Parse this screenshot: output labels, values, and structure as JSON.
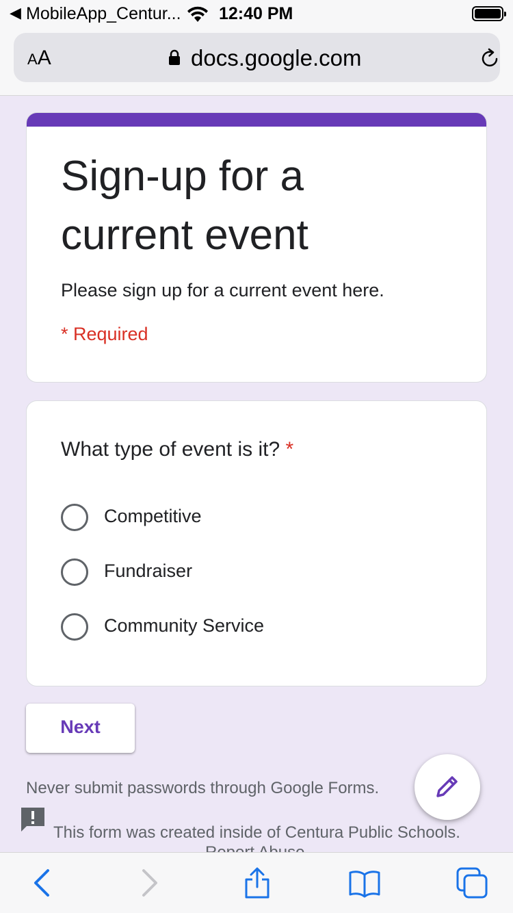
{
  "status_bar": {
    "back_app": "MobileApp_Centur...",
    "time": "12:40 PM"
  },
  "browser": {
    "text_size_small": "A",
    "text_size_big": "A",
    "url": "docs.google.com"
  },
  "form": {
    "accent_color": "#673ab7",
    "title": "Sign-up for a current event",
    "description": "Please sign up for a current event here.",
    "required_note": "* Required"
  },
  "question": {
    "title": "What type of event is it?",
    "required_mark": "*",
    "options": [
      {
        "label": "Competitive"
      },
      {
        "label": "Fundraiser"
      },
      {
        "label": "Community Service"
      }
    ]
  },
  "actions": {
    "next_label": "Next"
  },
  "footer": {
    "warning": "Never submit passwords through Google Forms.",
    "org_note": "This form was created inside of Centura Public Schools.",
    "report": "Report Abuse"
  },
  "icons": {
    "back": "back-arrow-icon",
    "wifi": "wifi-icon",
    "battery": "battery-icon",
    "lock": "lock-icon",
    "reload": "reload-icon",
    "report": "report-abuse-icon",
    "edit": "pencil-icon",
    "nav_back": "chevron-left-icon",
    "nav_forward": "chevron-right-icon",
    "share": "share-icon",
    "bookmarks": "book-icon",
    "tabs": "tabs-icon"
  }
}
